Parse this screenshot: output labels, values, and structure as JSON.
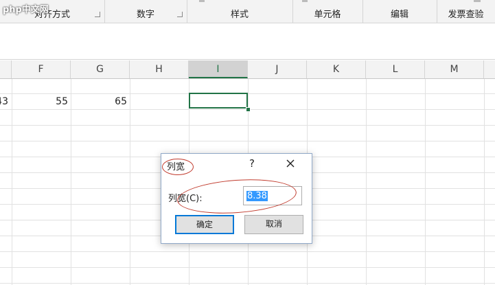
{
  "watermark": "php中文网",
  "ribbon": {
    "groups": [
      {
        "label": "对齐方式"
      },
      {
        "label": "数字"
      },
      {
        "label": "样式"
      },
      {
        "label": "单元格"
      },
      {
        "label": "编辑"
      },
      {
        "label": "发票查验"
      }
    ]
  },
  "columns": [
    "F",
    "G",
    "H",
    "I",
    "J",
    "K",
    "L",
    "M"
  ],
  "selected_column": "I",
  "cells": {
    "e_partial": "43",
    "f": "55",
    "g": "65"
  },
  "dialog": {
    "title": "列宽",
    "help": "?",
    "field_label": "列宽(C):",
    "field_value": "8.38",
    "ok_label": "确定",
    "cancel_label": "取消"
  },
  "colors": {
    "accent_green": "#217346",
    "dialog_focus": "#0078d7",
    "annotation_red": "#c0392b",
    "selection_blue": "#3399ff"
  }
}
